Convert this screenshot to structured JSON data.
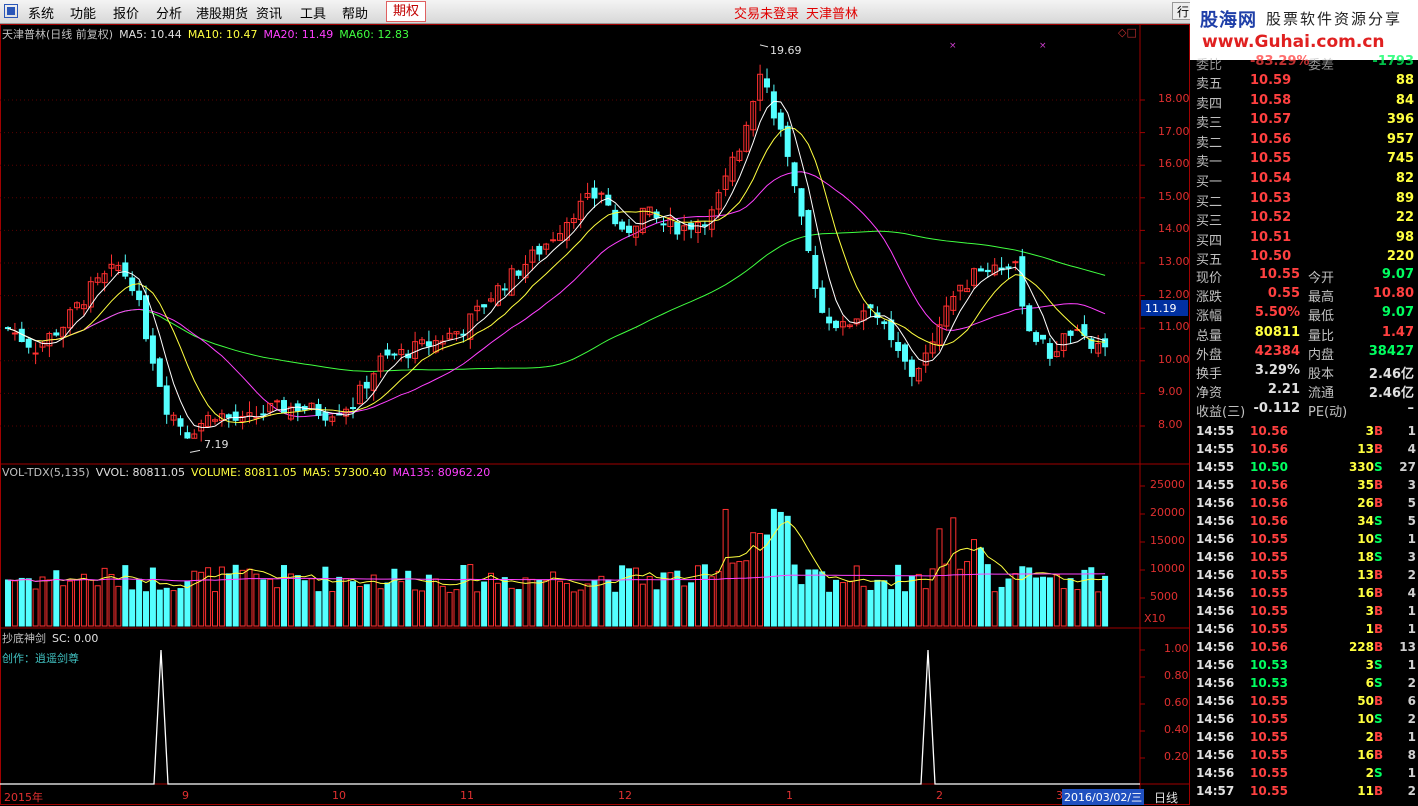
{
  "menu": {
    "items": [
      "系统",
      "功能",
      "报价",
      "分析",
      "港股期货",
      "资讯",
      "工具",
      "帮助"
    ],
    "active": "期权",
    "login_status": "交易未登录",
    "stock_name": "天津普林",
    "tab_label": "行"
  },
  "brand": {
    "line1": "股海网",
    "line1b": "股票软件资源分享",
    "line2": "www.Guhai.com.cn"
  },
  "kline": {
    "title": "天津普林(日线 前复权)",
    "ma5": "MA5: 10.44",
    "ma10": "MA10: 10.47",
    "ma20": "MA20: 11.49",
    "ma60": "MA60: 12.83",
    "high_mark": "19.69",
    "low_mark": "7.19",
    "price_marker": "11.19",
    "y_ticks": [
      "18.00",
      "17.00",
      "16.00",
      "15.00",
      "14.00",
      "13.00",
      "12.00",
      "11.00",
      "10.00",
      "9.00",
      "8.00"
    ]
  },
  "volume": {
    "title": "VOL-TDX(5,135)",
    "vvol": "VVOL: 80811.05",
    "volume": "VOLUME: 80811.05",
    "ma5": "MA5: 57300.40",
    "ma135": "MA135: 80962.20",
    "unit": "X10",
    "y_ticks": [
      "25000",
      "20000",
      "15000",
      "10000",
      "5000"
    ]
  },
  "indicator": {
    "title": "抄底神剑",
    "sc": "SC: 0.00",
    "author": "创作：逍遥剑尊",
    "y_ticks": [
      "1.00",
      "0.80",
      "0.60",
      "0.40",
      "0.20"
    ]
  },
  "xaxis": {
    "labels": [
      "2015年",
      "9",
      "10",
      "11",
      "12",
      "1",
      "2",
      "3"
    ],
    "date": "2016/03/02/三",
    "period": "日线"
  },
  "quote": {
    "top_partial": {
      "label": "委比",
      "value": "-83.29%",
      "label2": "委差",
      "value2": "-1793"
    },
    "asks": [
      {
        "label": "卖五",
        "price": "10.59",
        "vol": "88"
      },
      {
        "label": "卖四",
        "price": "10.58",
        "vol": "84"
      },
      {
        "label": "卖三",
        "price": "10.57",
        "vol": "396"
      },
      {
        "label": "卖二",
        "price": "10.56",
        "vol": "957"
      },
      {
        "label": "卖一",
        "price": "10.55",
        "vol": "745"
      }
    ],
    "bids": [
      {
        "label": "买一",
        "price": "10.54",
        "vol": "82"
      },
      {
        "label": "买二",
        "price": "10.53",
        "vol": "89"
      },
      {
        "label": "买三",
        "price": "10.52",
        "vol": "22"
      },
      {
        "label": "买四",
        "price": "10.51",
        "vol": "98"
      },
      {
        "label": "买五",
        "price": "10.50",
        "vol": "220"
      }
    ],
    "stats": [
      {
        "l1": "现价",
        "v1": "10.55",
        "l2": "今开",
        "v2": "9.07",
        "c1": "red",
        "c2": "grn"
      },
      {
        "l1": "涨跌",
        "v1": "0.55",
        "l2": "最高",
        "v2": "10.80",
        "c1": "red",
        "c2": "red"
      },
      {
        "l1": "涨幅",
        "v1": "5.50%",
        "l2": "最低",
        "v2": "9.07",
        "c1": "red",
        "c2": "grn"
      },
      {
        "l1": "总量",
        "v1": "80811",
        "l2": "量比",
        "v2": "1.47",
        "c1": "yel",
        "c2": "red"
      },
      {
        "l1": "外盘",
        "v1": "42384",
        "l2": "内盘",
        "v2": "38427",
        "c1": "red",
        "c2": "grn"
      }
    ],
    "stats2": [
      {
        "l1": "换手",
        "v1": "3.29%",
        "l2": "股本",
        "v2": "2.46亿"
      },
      {
        "l1": "净资",
        "v1": "2.21",
        "l2": "流通",
        "v2": "2.46亿"
      },
      {
        "l1": "收益(三)",
        "v1": "-0.112",
        "l2": "PE(动)",
        "v2": "–"
      }
    ],
    "ticks": [
      {
        "t": "14:55",
        "p": "10.56",
        "v": "3",
        "f": "B",
        "n": "1"
      },
      {
        "t": "14:55",
        "p": "10.56",
        "v": "13",
        "f": "B",
        "n": "4"
      },
      {
        "t": "14:55",
        "p": "10.50",
        "v": "330",
        "f": "S",
        "n": "27"
      },
      {
        "t": "14:55",
        "p": "10.56",
        "v": "35",
        "f": "B",
        "n": "3"
      },
      {
        "t": "14:56",
        "p": "10.56",
        "v": "26",
        "f": "B",
        "n": "5"
      },
      {
        "t": "14:56",
        "p": "10.56",
        "v": "34",
        "f": "S",
        "n": "5"
      },
      {
        "t": "14:56",
        "p": "10.55",
        "v": "10",
        "f": "S",
        "n": "1"
      },
      {
        "t": "14:56",
        "p": "10.55",
        "v": "18",
        "f": "S",
        "n": "3"
      },
      {
        "t": "14:56",
        "p": "10.55",
        "v": "13",
        "f": "B",
        "n": "2"
      },
      {
        "t": "14:56",
        "p": "10.55",
        "v": "16",
        "f": "B",
        "n": "4"
      },
      {
        "t": "14:56",
        "p": "10.55",
        "v": "3",
        "f": "B",
        "n": "1"
      },
      {
        "t": "14:56",
        "p": "10.55",
        "v": "1",
        "f": "B",
        "n": "1"
      },
      {
        "t": "14:56",
        "p": "10.56",
        "v": "228",
        "f": "B",
        "n": "13"
      },
      {
        "t": "14:56",
        "p": "10.53",
        "v": "3",
        "f": "S",
        "n": "1"
      },
      {
        "t": "14:56",
        "p": "10.53",
        "v": "6",
        "f": "S",
        "n": "2"
      },
      {
        "t": "14:56",
        "p": "10.55",
        "v": "50",
        "f": "B",
        "n": "6"
      },
      {
        "t": "14:56",
        "p": "10.55",
        "v": "10",
        "f": "S",
        "n": "2"
      },
      {
        "t": "14:56",
        "p": "10.55",
        "v": "2",
        "f": "B",
        "n": "1"
      },
      {
        "t": "14:56",
        "p": "10.55",
        "v": "16",
        "f": "B",
        "n": "8"
      },
      {
        "t": "14:56",
        "p": "10.55",
        "v": "2",
        "f": "S",
        "n": "1"
      },
      {
        "t": "14:57",
        "p": "10.55",
        "v": "11",
        "f": "B",
        "n": "2"
      }
    ]
  }
}
